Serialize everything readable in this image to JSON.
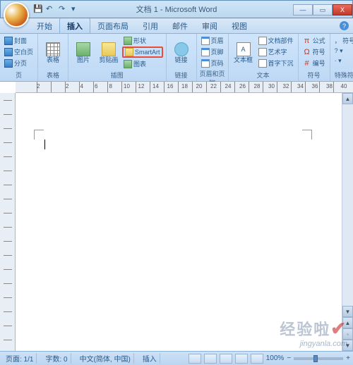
{
  "window": {
    "title": "文档 1 - Microsoft Word",
    "min": "—",
    "max": "▭",
    "close": "X",
    "help": "?"
  },
  "qat": {
    "save": "💾",
    "undo": "↶",
    "redo": "↷",
    "more": "▾"
  },
  "tabs": {
    "t0": "开始",
    "t1": "插入",
    "t2": "页面布局",
    "t3": "引用",
    "t4": "邮件",
    "t5": "审阅",
    "t6": "视图"
  },
  "ribbon": {
    "pages": {
      "label": "页",
      "cover": "封面",
      "blank": "空白页",
      "break": "分页"
    },
    "tables": {
      "label": "表格",
      "btn": "表格"
    },
    "illus": {
      "label": "插图",
      "picture": "图片",
      "clipart": "剪贴画",
      "shapes": "形状",
      "smartart": "SmartArt",
      "chart": "图表"
    },
    "links": {
      "label": "链接",
      "btn": "链接"
    },
    "hf": {
      "label": "页眉和页脚",
      "header": "页眉",
      "footer": "页脚",
      "pagenum": "页码"
    },
    "text": {
      "label": "文本",
      "textbox": "文本框",
      "docparts": "文档部件",
      "wordart": "艺术字",
      "dropcap": "首字下沉",
      "a": "A"
    },
    "symbols": {
      "label": "符号",
      "equation": "公式",
      "symbol": "符号",
      "number": "编号",
      "pi": "π",
      "omega": "Ω",
      "hash": "#"
    },
    "special": {
      "label": "特殊符号",
      "more": "， 符号 ▾",
      "q": "? ▾",
      "dot": "· ▾"
    }
  },
  "ruler": {
    "nums": [
      "2",
      "",
      "2",
      "4",
      "6",
      "8",
      "10",
      "12",
      "14",
      "16",
      "18",
      "20",
      "22",
      "24",
      "26",
      "28",
      "30",
      "32",
      "34",
      "36",
      "38",
      "40"
    ]
  },
  "status": {
    "page": "页面: 1/1",
    "words": "字数: 0",
    "lang": "中文(简体, 中国)",
    "mode": "插入",
    "zoom_minus": "−",
    "zoom_plus": "+",
    "zoom_pct": "100%"
  },
  "scroll": {
    "up": "▲",
    "down": "▼",
    "prev": "◂",
    "dot": "◦",
    "next": "▸",
    "left": "◀",
    "right": "▶"
  },
  "watermark": {
    "cn": "经验啦",
    "check": "✔",
    "en": "jingyanla.com"
  },
  "chart_data": {
    "type": "table",
    "note": "blank document, no chart"
  }
}
